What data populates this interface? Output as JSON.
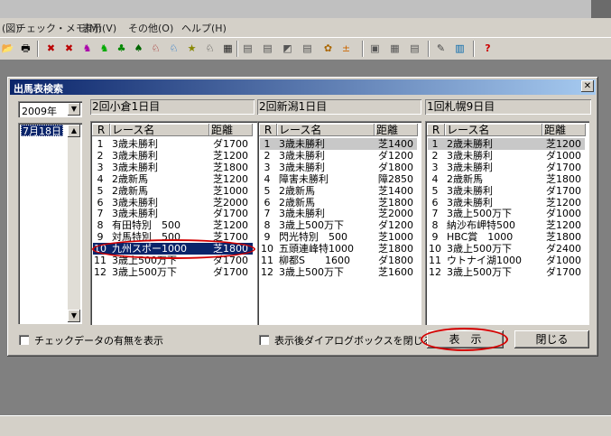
{
  "app": {
    "menu": [
      "(図)",
      "チェック・メモ(M)",
      "表示(V)",
      "その他(O)",
      "ヘルプ(H)"
    ]
  },
  "dialog": {
    "title": "出馬表検索",
    "close_glyph": "✕",
    "year": "2009年",
    "dates": [
      "7月18日"
    ],
    "col_headers": {
      "r": "R",
      "name": "レース名",
      "dist": "距離"
    },
    "meetings": [
      {
        "label": "2回小倉1日目",
        "races": [
          {
            "r": "1",
            "name": "3歳未勝利",
            "dist": "ダ1700"
          },
          {
            "r": "2",
            "name": "3歳未勝利",
            "dist": "芝1200"
          },
          {
            "r": "3",
            "name": "3歳未勝利",
            "dist": "芝1800"
          },
          {
            "r": "4",
            "name": "2歳新馬",
            "dist": "芝1200"
          },
          {
            "r": "5",
            "name": "2歳新馬",
            "dist": "芝1000"
          },
          {
            "r": "6",
            "name": "3歳未勝利",
            "dist": "芝2000"
          },
          {
            "r": "7",
            "name": "3歳未勝利",
            "dist": "ダ1700"
          },
          {
            "r": "8",
            "name": "有田特別　500",
            "dist": "芝1200"
          },
          {
            "r": "9",
            "name": "対馬特別　500",
            "dist": "芝1700"
          },
          {
            "r": "10",
            "name": "九州スポー1000",
            "dist": "芝1800"
          },
          {
            "r": "11",
            "name": "3歳上500万下",
            "dist": "ダ1700"
          },
          {
            "r": "12",
            "name": "3歳上500万下",
            "dist": "ダ1700"
          }
        ]
      },
      {
        "label": "2回新潟1日目",
        "races": [
          {
            "r": "1",
            "name": "3歳未勝利",
            "dist": "芝1400"
          },
          {
            "r": "2",
            "name": "3歳未勝利",
            "dist": "ダ1200"
          },
          {
            "r": "3",
            "name": "3歳未勝利",
            "dist": "ダ1800"
          },
          {
            "r": "4",
            "name": "障害未勝利",
            "dist": "障2850"
          },
          {
            "r": "5",
            "name": "2歳新馬",
            "dist": "芝1400"
          },
          {
            "r": "6",
            "name": "2歳新馬",
            "dist": "芝1800"
          },
          {
            "r": "7",
            "name": "3歳未勝利",
            "dist": "芝2000"
          },
          {
            "r": "8",
            "name": "3歳上500万下",
            "dist": "ダ1200"
          },
          {
            "r": "9",
            "name": "閃光特別　500",
            "dist": "芝1000"
          },
          {
            "r": "10",
            "name": "五頭連峰特1000",
            "dist": "芝1800"
          },
          {
            "r": "11",
            "name": "柳都S　　1600",
            "dist": "ダ1800"
          },
          {
            "r": "12",
            "name": "3歳上500万下",
            "dist": "芝1600"
          }
        ]
      },
      {
        "label": "1回札幌9日目",
        "races": [
          {
            "r": "1",
            "name": "2歳未勝利",
            "dist": "芝1200"
          },
          {
            "r": "2",
            "name": "3歳未勝利",
            "dist": "ダ1000"
          },
          {
            "r": "3",
            "name": "3歳未勝利",
            "dist": "ダ1700"
          },
          {
            "r": "4",
            "name": "2歳新馬",
            "dist": "芝1800"
          },
          {
            "r": "5",
            "name": "3歳未勝利",
            "dist": "ダ1700"
          },
          {
            "r": "6",
            "name": "3歳未勝利",
            "dist": "芝1200"
          },
          {
            "r": "7",
            "name": "3歳上500万下",
            "dist": "ダ1000"
          },
          {
            "r": "8",
            "name": "納沙布岬特500",
            "dist": "芝1200"
          },
          {
            "r": "9",
            "name": "HBC賞　1000",
            "dist": "芝1800"
          },
          {
            "r": "10",
            "name": "3歳上500万下",
            "dist": "ダ2400"
          },
          {
            "r": "11",
            "name": "ウトナイ湖1000",
            "dist": "ダ1000"
          },
          {
            "r": "12",
            "name": "3歳上500万下",
            "dist": "ダ1700"
          }
        ]
      }
    ],
    "check_show_data": "チェックデータの有無を表示",
    "check_close_after": "表示後ダイアログボックスを閉じる",
    "show_button": "表　示",
    "close_button": "閉じる"
  },
  "colors": {
    "titlebar": "#0a246a",
    "highlight": "#0a246a",
    "annotation": "#d40000"
  }
}
